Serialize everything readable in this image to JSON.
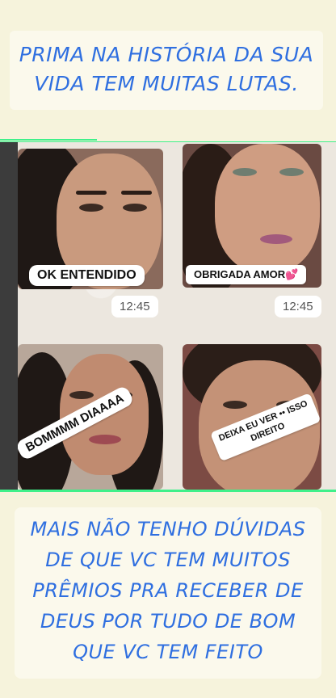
{
  "top_caption": {
    "line1": "PRIMA NA HISTÓRIA DA SUA",
    "line2": "VIDA TEM MUITAS LUTAS."
  },
  "stickers": [
    {
      "label": "OK  ENTENDIDO",
      "time": "12:45"
    },
    {
      "label": "OBRIGADA AMOR💕",
      "time": "12:45"
    },
    {
      "label": "BOMMMM DIAAAA"
    },
    {
      "label_line1": "DEIXA EU VER •• ISSO",
      "label_line2": "DIREITO"
    }
  ],
  "bottom_caption": {
    "line1": "MAIS NÃO TENHO DÚVIDAS",
    "line2": "DE QUE VC TEM MUITOS",
    "line3": "PRÊMIOS PRA RECEBER DE",
    "line4": "DEUS POR TUDO DE BOM",
    "line5": "QUE VC TEM FEITO"
  },
  "colors": {
    "caption_text": "#2f6fe0",
    "background": "#f6f3dc",
    "divider": "#3ff08a"
  }
}
